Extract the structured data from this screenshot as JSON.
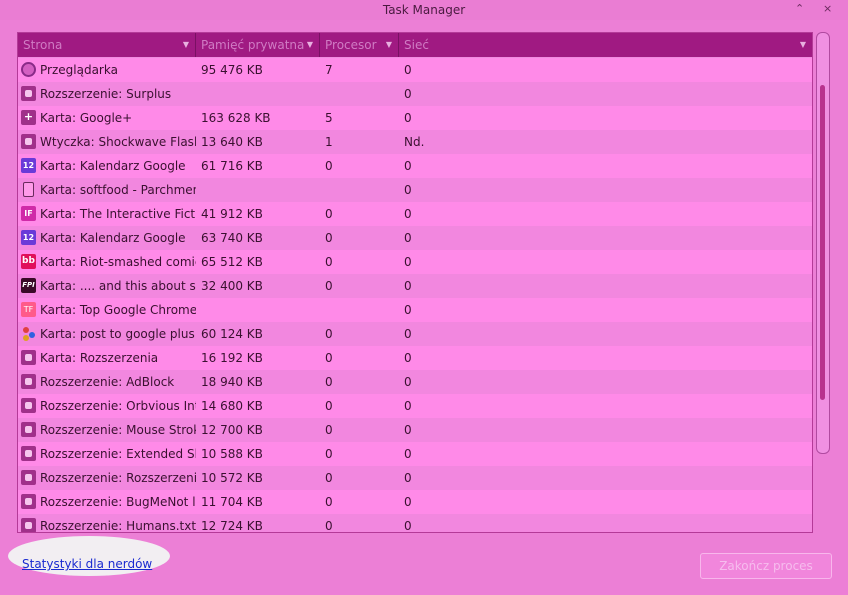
{
  "window": {
    "title": "Task Manager",
    "controls": [
      "⌃",
      "×"
    ]
  },
  "table": {
    "columns": [
      "Strona",
      "Pamięć prywatna",
      "Procesor",
      "Sieć"
    ],
    "rows": [
      {
        "icon": "browser-icon",
        "name": "Przeglądarka",
        "memory": "95 476 KB",
        "cpu": "7",
        "network": "0"
      },
      {
        "icon": "extension-icon",
        "name": "Rozszerzenie: Surplus",
        "memory": "",
        "cpu": "",
        "network": "0"
      },
      {
        "icon": "google-plus-icon",
        "name": "Karta: Google+",
        "memory": "163 628 KB",
        "cpu": "5",
        "network": "0"
      },
      {
        "icon": "extension-icon",
        "name": "Wtyczka: Shockwave Flash",
        "memory": "13 640 KB",
        "cpu": "1",
        "network": "Nd."
      },
      {
        "icon": "calendar-icon",
        "name": "Karta: Kalendarz Google",
        "memory": "61 716 KB",
        "cpu": "0",
        "network": "0"
      },
      {
        "icon": "document-icon",
        "name": "Karta: softfood - Parchment",
        "memory": "",
        "cpu": "",
        "network": "0"
      },
      {
        "icon": "if-logo-icon",
        "name": "Karta: The Interactive Fiction",
        "memory": "41 912 KB",
        "cpu": "0",
        "network": "0"
      },
      {
        "icon": "calendar-icon",
        "name": "Karta: Kalendarz Google",
        "memory": "63 740 KB",
        "cpu": "0",
        "network": "0"
      },
      {
        "icon": "bb-logo-icon",
        "name": "Karta: Riot-smashed comic",
        "memory": "65 512 KB",
        "cpu": "0",
        "network": "0"
      },
      {
        "icon": "fpi-logo-icon",
        "name": "Karta: .... and this about su",
        "memory": "32 400 KB",
        "cpu": "0",
        "network": "0"
      },
      {
        "icon": "tf-logo-icon",
        "name": "Karta: Top Google Chrome",
        "memory": "",
        "cpu": "",
        "network": "0"
      },
      {
        "icon": "google-dots-icon",
        "name": "Karta: post to google plus",
        "memory": "60 124 KB",
        "cpu": "0",
        "network": "0"
      },
      {
        "icon": "extension-icon",
        "name": "Karta: Rozszerzenia",
        "memory": "16 192 KB",
        "cpu": "0",
        "network": "0"
      },
      {
        "icon": "extension-icon",
        "name": "Rozszerzenie: AdBlock",
        "memory": "18 940 KB",
        "cpu": "0",
        "network": "0"
      },
      {
        "icon": "extension-icon",
        "name": "Rozszerzenie: Orbvious Int",
        "memory": "14 680 KB",
        "cpu": "0",
        "network": "0"
      },
      {
        "icon": "extension-icon",
        "name": "Rozszerzenie: Mouse Stroke",
        "memory": "12 700 KB",
        "cpu": "0",
        "network": "0"
      },
      {
        "icon": "extension-icon",
        "name": "Rozszerzenie: Extended Sh",
        "memory": "10 588 KB",
        "cpu": "0",
        "network": "0"
      },
      {
        "icon": "extension-icon",
        "name": "Rozszerzenie: Rozszerzenia",
        "memory": "10 572 KB",
        "cpu": "0",
        "network": "0"
      },
      {
        "icon": "extension-icon",
        "name": "Rozszerzenie: BugMeNot l",
        "memory": "11 704 KB",
        "cpu": "0",
        "network": "0"
      },
      {
        "icon": "extension-icon",
        "name": "Rozszerzenie: Humans.txt",
        "memory": "12 724 KB",
        "cpu": "0",
        "network": "0"
      }
    ]
  },
  "footer": {
    "stats_link": "Statystyki dla nerdów",
    "end_process": "Zakończ proces"
  }
}
